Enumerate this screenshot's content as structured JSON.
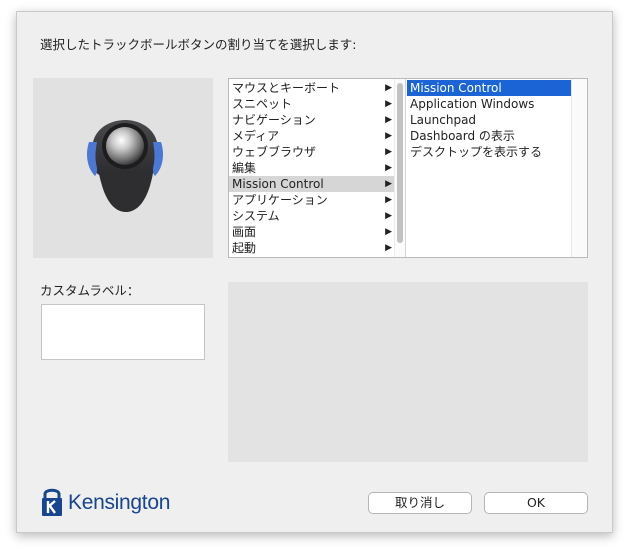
{
  "dialog": {
    "prompt": "選択したトラックボールボタンの割り当てを選択します:",
    "custom_label_title": "カスタムラベル：",
    "custom_label_value": "",
    "cancel_label": "取り消し",
    "ok_label": "OK"
  },
  "logo": {
    "brand": "Kensington",
    "color": "#17458f"
  },
  "categories": [
    {
      "label": "マウスとキーボート",
      "has_submenu": true
    },
    {
      "label": "スニペット",
      "has_submenu": true
    },
    {
      "label": "ナビゲーション",
      "has_submenu": true
    },
    {
      "label": "メディア",
      "has_submenu": true
    },
    {
      "label": "ウェブブラウザ",
      "has_submenu": true
    },
    {
      "label": "編集",
      "has_submenu": true
    },
    {
      "label": "Mission Control",
      "has_submenu": true,
      "selected": true
    },
    {
      "label": "アプリケーション",
      "has_submenu": true
    },
    {
      "label": "システム",
      "has_submenu": true
    },
    {
      "label": "画面",
      "has_submenu": true
    },
    {
      "label": "起動",
      "has_submenu": true
    }
  ],
  "actions": [
    {
      "label": "Mission Control",
      "selected": true
    },
    {
      "label": "Application Windows"
    },
    {
      "label": "Launchpad"
    },
    {
      "label": "Dashboard の表示"
    },
    {
      "label": "デスクトップを表示する"
    }
  ],
  "colors": {
    "selection_blue": "#1a64d6",
    "selection_gray": "#d6d6d6",
    "button_highlight": "#4a78d4"
  }
}
